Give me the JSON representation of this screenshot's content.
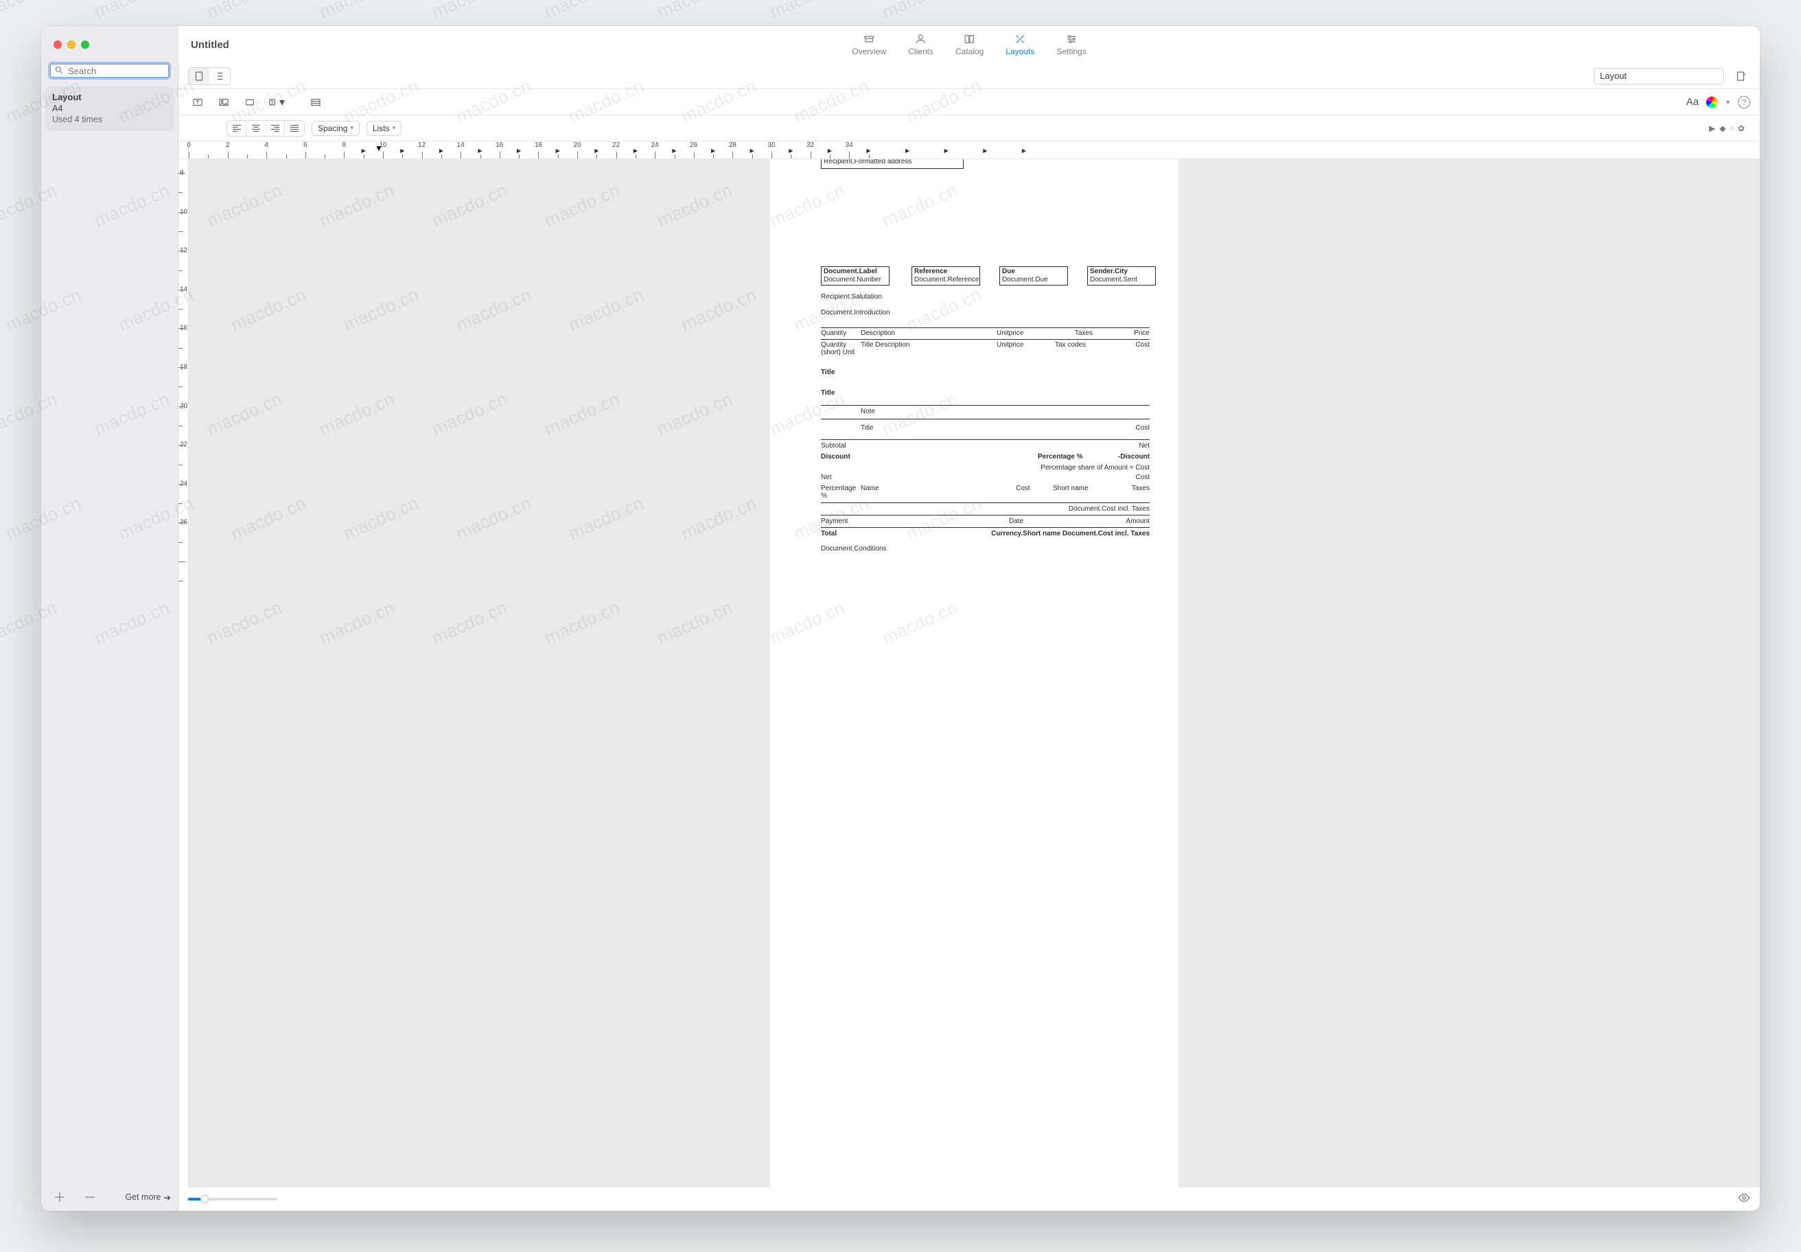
{
  "watermark_text": "macdo.cn",
  "window": {
    "title": "Untitled"
  },
  "main_tabs": [
    {
      "label": "Overview"
    },
    {
      "label": "Clients"
    },
    {
      "label": "Catalog"
    },
    {
      "label": "Layouts",
      "active": true
    },
    {
      "label": "Settings"
    }
  ],
  "sidebar": {
    "search_placeholder": "Search",
    "item": {
      "title": "Layout",
      "line2": "A4",
      "line3": "Used 4 times"
    },
    "get_more": "Get more"
  },
  "row1": {
    "layout_input_value": "Layout"
  },
  "row2": {
    "Aa_label": "Aa"
  },
  "row3": {
    "spacing_label": "Spacing",
    "lists_label": "Lists"
  },
  "ruler": {
    "h_numbers": [
      "0",
      "2",
      "4",
      "6",
      "8",
      "10",
      "12",
      "14",
      "16",
      "18",
      "20",
      "22",
      "24",
      "26",
      "28",
      "30",
      "32",
      "34"
    ],
    "v_numbers": [
      "8",
      "10",
      "12",
      "14",
      "16",
      "18",
      "20",
      "22",
      "24",
      "26"
    ]
  },
  "page": {
    "recipient_box": "Recipient.Formatted address",
    "header_boxes": [
      {
        "bold": "Document.Label",
        "sub": "Document.Number"
      },
      {
        "bold": "Reference",
        "sub": "Document.Reference"
      },
      {
        "bold": "Due",
        "sub": "Document.Due"
      },
      {
        "bold": "Sender.City",
        "sub": "Document.Sent"
      }
    ],
    "salutation": "Recipient.Salutation",
    "introduction": "Document.Introduction",
    "table_head": {
      "c1": "Quantity",
      "c2": "Description",
      "c3": "Unitprice",
      "c4": "Taxes",
      "c5": "Price"
    },
    "table_row2": {
      "a": "Quantity (short) Unit",
      "b": "Title Description",
      "c": "Unitprice",
      "d": "Tax codes",
      "e": "Cost"
    },
    "title1": "Title",
    "title2": "Title",
    "note": "Note",
    "row_title_cost": {
      "l": "Title",
      "r": "Cost"
    },
    "subtotal": {
      "l": "Subtotal",
      "r": "Net"
    },
    "discount": {
      "l": "Discount",
      "m": "Percentage %",
      "r": "-Discount"
    },
    "pct_share": "Percentage share of Amount = Cost",
    "net": {
      "l": "Net",
      "r": "Cost"
    },
    "pct_row": {
      "a": "Percentage %",
      "b": "Name",
      "c": "Cost",
      "d": "Short name",
      "e": "Taxes"
    },
    "cost_incl": "Document.Cost incl. Taxes",
    "payment_row": {
      "l": "Payment",
      "m": "Date",
      "r": "Amount"
    },
    "total_row": {
      "l": "Total",
      "r": "Currency.Short name Document.Cost incl. Taxes"
    },
    "conditions": "Document.Conditions"
  }
}
